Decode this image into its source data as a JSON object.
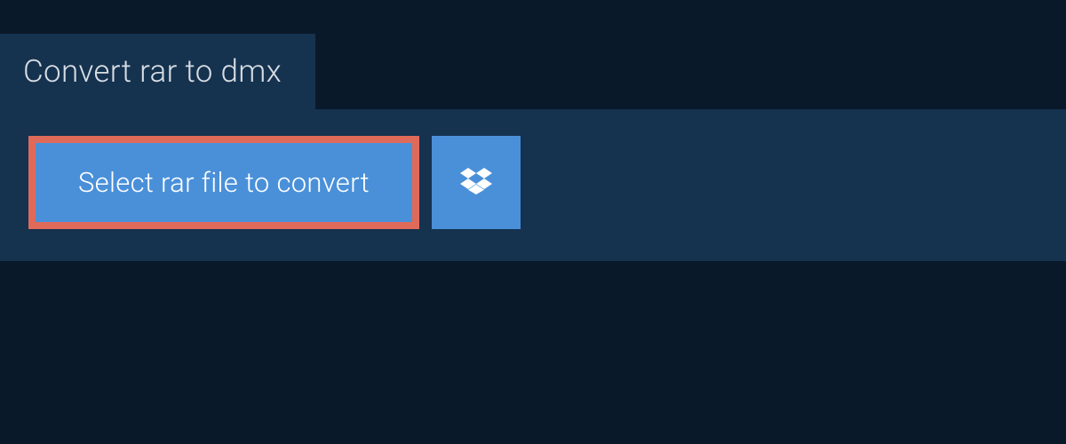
{
  "header": {
    "title": "Convert rar to dmx"
  },
  "actions": {
    "select_label": "Select rar file to convert",
    "dropbox_icon": "dropbox-icon"
  },
  "colors": {
    "background": "#0a1929",
    "panel": "#15324f",
    "button": "#4a90d9",
    "highlight_border": "#e06a5a",
    "text_light": "#d8dee4",
    "text_white": "#ffffff"
  }
}
